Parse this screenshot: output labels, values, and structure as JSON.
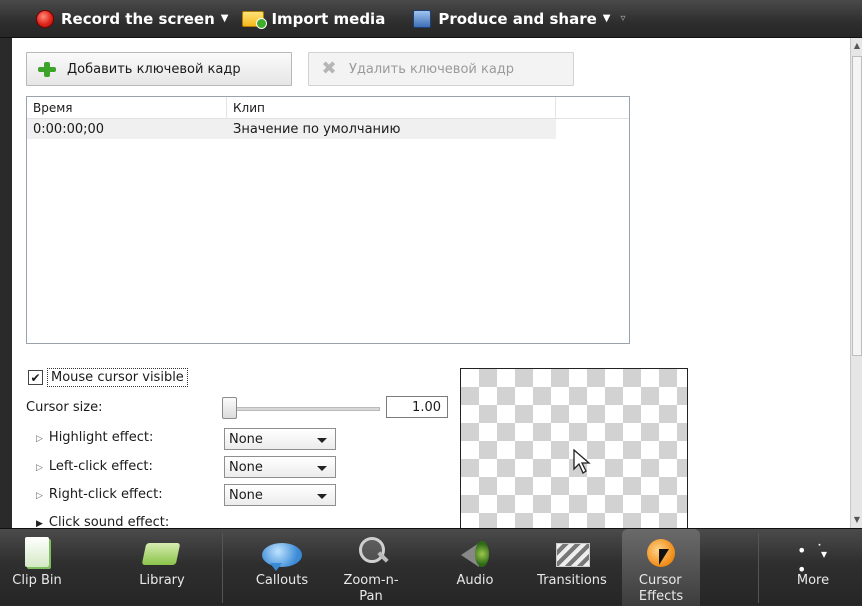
{
  "toolbar": {
    "record_label": "Record the screen",
    "import_label": "Import media",
    "produce_label": "Produce and share"
  },
  "keyframes": {
    "add_label": "Добавить ключевой кадр",
    "remove_label": "Удалить ключевой кадр",
    "columns": [
      "Время",
      "Клип"
    ],
    "rows": [
      {
        "time": "0:00:00;00",
        "clip": "Значение по умолчанию"
      }
    ]
  },
  "cursor_options": {
    "visible_label": "Mouse cursor visible",
    "visible_checked": true,
    "size_label": "Cursor size:",
    "size_value": "1.00",
    "size_slider_fraction": 0.0,
    "highlight_label": "Highlight effect:",
    "highlight_value": "None",
    "leftclick_label": "Left-click effect:",
    "leftclick_value": "None",
    "rightclick_label": "Right-click effect:",
    "rightclick_value": "None",
    "sound_label": "Click sound effect:"
  },
  "dock": {
    "items": [
      {
        "label": "Clip Bin",
        "icon": "clip-bin-icon"
      },
      {
        "label": "Library",
        "icon": "library-icon"
      },
      {
        "label": "Callouts",
        "icon": "callouts-icon"
      },
      {
        "label": "Zoom-n-\nPan",
        "icon": "zoom-icon"
      },
      {
        "label": "Audio",
        "icon": "audio-icon"
      },
      {
        "label": "Transitions",
        "icon": "transitions-icon"
      },
      {
        "label": "Cursor\nEffects",
        "icon": "cursor-effects-icon"
      },
      {
        "label": "More",
        "icon": "more-icon"
      }
    ],
    "active": "Cursor Effects"
  }
}
